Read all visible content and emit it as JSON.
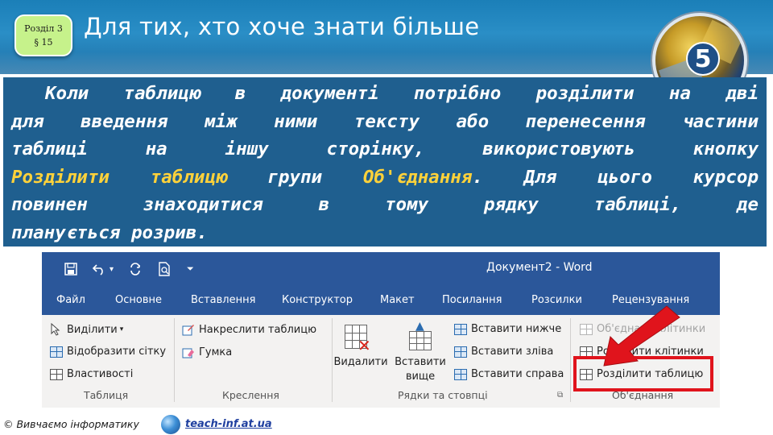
{
  "header": {
    "section_line1": "Розділ 3",
    "section_line2": "§ 15",
    "title": "Для тих, хто хоче знати більше",
    "logo_number": "5"
  },
  "body_text": {
    "line1": "Коли таблицю в документі потрібно розділити на дві",
    "line2": "для введення між ними тексту або перенесення частини",
    "line3": "таблиці на іншу сторінку, використовують кнопку",
    "line4_hl1": "Розділити таблицю",
    "line4_mid": " групи ",
    "line4_hl2": "Об'єднання",
    "line4_end": ". Для цього курсор",
    "line5": "повинен знаходитися в тому рядку таблиці, де",
    "line6": "планується розрив."
  },
  "ribbon": {
    "doc_title": "Документ2 - Word",
    "tabs": [
      "Файл",
      "Основне",
      "Вставлення",
      "Конструктор",
      "Макет",
      "Посилання",
      "Розсилки",
      "Рецензування"
    ],
    "table_group": {
      "select": "Виділити",
      "grid": "Відобразити сітку",
      "properties": "Властивості",
      "label": "Таблиця"
    },
    "draw_group": {
      "draw": "Накреслити таблицю",
      "eraser": "Гумка",
      "label": "Креслення"
    },
    "rows_group": {
      "delete": "Видалити",
      "insert_above_1": "Вставити",
      "insert_above_2": "вище",
      "insert_below": "Вставити нижче",
      "insert_left": "Вставити зліва",
      "insert_right": "Вставити справа",
      "label": "Рядки та стовпці"
    },
    "merge_group": {
      "merge": "Об'єднати клітинки",
      "split_cells": "Розділити клітинки",
      "split_table": "Розділити таблицю",
      "label": "Об'єднання"
    }
  },
  "footer": {
    "copyright": "© Вивчаємо інформатику",
    "link": "teach-inf.at.ua"
  },
  "colors": {
    "header_blue": "#1b7fb8",
    "text_box_blue": "#1f5f8f",
    "highlight_yellow": "#ffd23a",
    "word_blue": "#2b579a",
    "highlight_red": "#e0141c",
    "badge_green": "#c6f28b"
  }
}
